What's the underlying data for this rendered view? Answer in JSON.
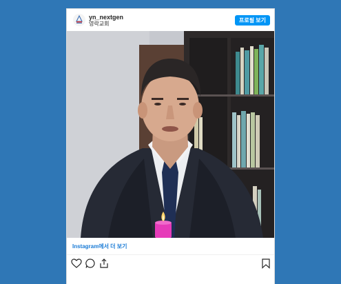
{
  "post": {
    "username": "yn_nextgen",
    "location": "영락교회",
    "profile_button": "프로필 보기",
    "more_link": "Instagram에서 더 보기"
  },
  "icons": {
    "avatar": "church-logo-icon",
    "like": "heart-icon",
    "comment": "comment-bubble-icon",
    "share": "share-upload-icon",
    "save": "bookmark-icon"
  },
  "colors": {
    "page_background": "#2f77b6",
    "accent": "#0095f6",
    "link": "#1a7bd6"
  }
}
